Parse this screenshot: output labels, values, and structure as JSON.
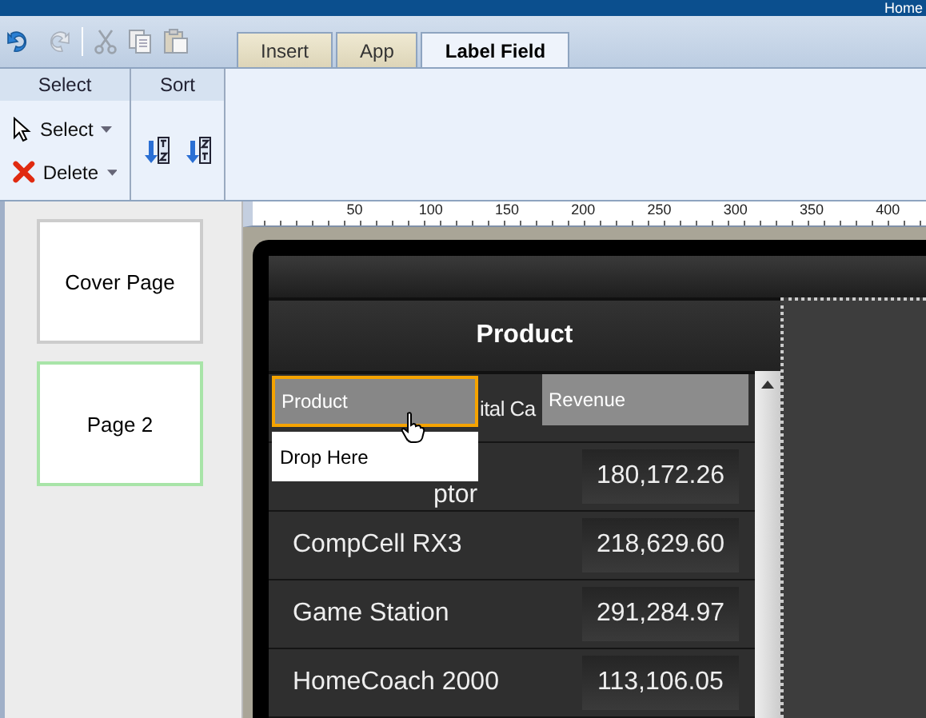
{
  "top_bar": {
    "title": "Home"
  },
  "tabs": [
    {
      "label": "Insert",
      "selected": false
    },
    {
      "label": "App",
      "selected": false
    },
    {
      "label": "Label Field",
      "selected": true
    }
  ],
  "ribbon": {
    "select_group": {
      "title": "Select",
      "items": [
        {
          "label": "Select"
        },
        {
          "label": "Delete"
        }
      ]
    },
    "sort_group": {
      "title": "Sort"
    }
  },
  "pages": [
    {
      "label": "Cover Page",
      "selected": false
    },
    {
      "label": "Page 2",
      "selected": true
    }
  ],
  "ruler": {
    "ticks": [
      "50",
      "100",
      "150",
      "200",
      "250",
      "300",
      "350",
      "400"
    ]
  },
  "table": {
    "header": "Product",
    "rows": [
      {
        "product": "ital Ca"
      },
      {
        "product": "ptor",
        "revenue": "180,172.26"
      },
      {
        "product": "CompCell RX3",
        "revenue": "218,629.60"
      },
      {
        "product": "Game Station",
        "revenue": "291,284.97"
      },
      {
        "product": "HomeCoach 2000",
        "revenue": "113,106.05"
      }
    ]
  },
  "drag": {
    "dragged_field": "Product",
    "drop_target": "Drop Here",
    "field": "Revenue"
  }
}
